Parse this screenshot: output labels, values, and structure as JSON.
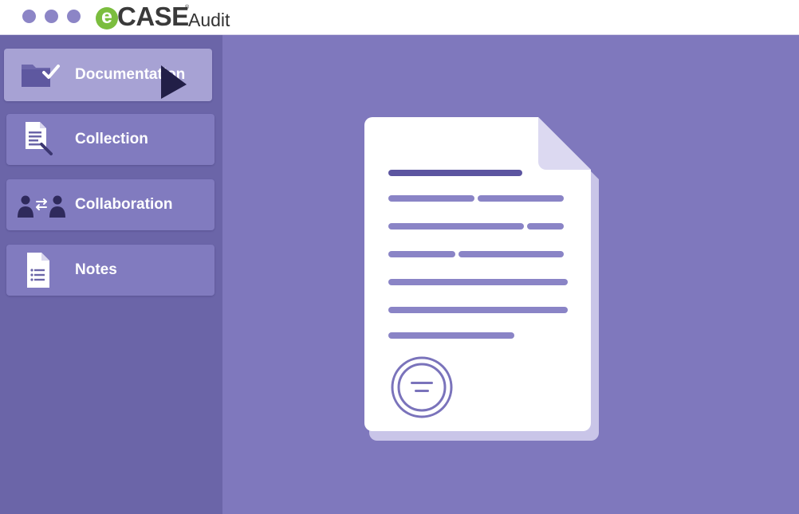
{
  "window": {
    "controls": [
      "window-dot",
      "window-dot",
      "window-dot"
    ],
    "control_color": "#8c85c6"
  },
  "brand": {
    "logo_e": "e",
    "logo_case": "CASE",
    "logo_registered": "®",
    "logo_product": "Audit",
    "accent_color": "#7bbd3e"
  },
  "sidebar": {
    "items": [
      {
        "label": "Documentation",
        "icon": "folder-check-icon",
        "active": true
      },
      {
        "label": "Collection",
        "icon": "document-collect-icon",
        "active": false
      },
      {
        "label": "Collaboration",
        "icon": "people-exchange-icon",
        "active": false
      },
      {
        "label": "Notes",
        "icon": "notes-list-icon",
        "active": false
      }
    ]
  },
  "main": {
    "illustration": "document-with-seal",
    "background_color": "#7f78bd"
  }
}
